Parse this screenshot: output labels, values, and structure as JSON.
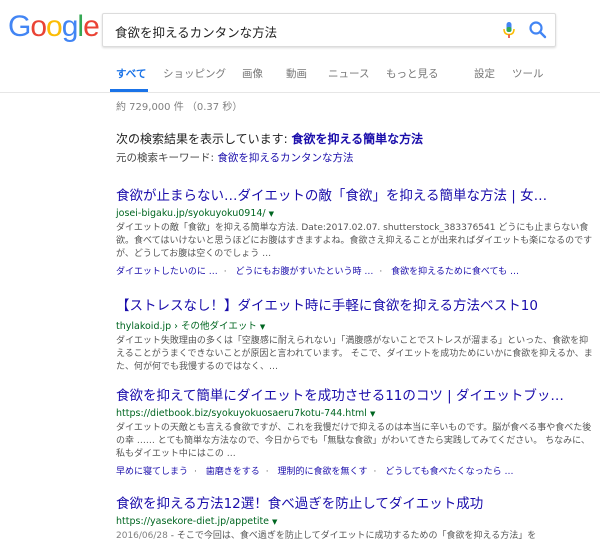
{
  "logo": {
    "text": "Google",
    "letters": [
      "G",
      "o",
      "o",
      "g",
      "l",
      "e"
    ],
    "colors": [
      "#4285F4",
      "#EA4335",
      "#FBBC05",
      "#4285F4",
      "#34A853",
      "#EA4335"
    ]
  },
  "search": {
    "value": "食欲を抑えるカンタンな方法",
    "mic_icon": "mic-icon",
    "search_icon": "search-icon"
  },
  "tabs": [
    {
      "label": "すべて",
      "active": true
    },
    {
      "label": "ショッピング"
    },
    {
      "label": "画像"
    },
    {
      "label": "動画"
    },
    {
      "label": "ニュース"
    },
    {
      "label": "もっと見る"
    },
    {
      "label": "設定"
    },
    {
      "label": "ツール"
    }
  ],
  "stats": "約 729,000 件 （0.37 秒）",
  "correction": {
    "prefix": "次の検索結果を表示しています: ",
    "corrected": "食欲を抑える簡単な方法",
    "orig_prefix": "元の検索キーワード: ",
    "original": "食欲を抑えるカンタンな方法"
  },
  "results": [
    {
      "title": "食欲が止まらない…ダイエットの敵「食欲」を抑える簡単な方法 | 女…",
      "url": "josei-bigaku.jp/syokuyoku0914/",
      "snippet": "ダイエットの敵「食欲」を抑える簡単な方法. Date:2017.02.07. shutterstock_383376541 どうにも止まらない食欲。食べてはいけないと思うほどにお腹はすきますよね。食欲さえ抑えることが出来ればダイエットも楽になるのですが、どうしてお腹は空くのでしょう …",
      "links": [
        "ダイエットしたいのに …",
        "どうにもお腹がすいたという時 …",
        "食欲を抑えるために食べても …"
      ]
    },
    {
      "title": "【ストレスなし！】ダイエット時に手軽に食欲を抑える方法ベスト10",
      "url": "thylakoid.jp › その他ダイエット",
      "snippet": "ダイエット失敗理由の多くは「空腹感に耐えられない」「満腹感がないことでストレスが溜まる」といった、食欲を抑えることがうまくできないことが原因と言われています。 そこで、ダイエットを成功ためにいかに食欲を抑えるか、また、何が何でも我慢するのではなく、…"
    },
    {
      "title": "食欲を抑えて簡単にダイエットを成功させる11のコツ | ダイエットブッ…",
      "url": "https://dietbook.biz/syokuyokuosaeru7kotu-744.html",
      "snippet": "ダイエットの天敵とも言える食欲ですが、これを我慢だけで抑えるのは本当に辛いものです。脳が食べる事や食べた後の幸 …… とても簡単な方法なので、今日からでも「無駄な食欲」がわいてきたら実践してみてください。 ちなみに、私もダイエット中にはこの …",
      "links": [
        "早めに寝てしまう",
        "歯磨きをする",
        "理制的に食欲を無くす",
        "どうしても食べたくなったら …"
      ]
    },
    {
      "title": "食欲を抑える方法12選！食べ過ぎを防止してダイエット成功",
      "url": "https://yasekore-diet.jp/appetite",
      "date": "2016/06/28",
      "snippet": "- そこで今回は、食べ過ぎを防止してダイエットに成功するための「食欲を抑える方法」を"
    }
  ]
}
